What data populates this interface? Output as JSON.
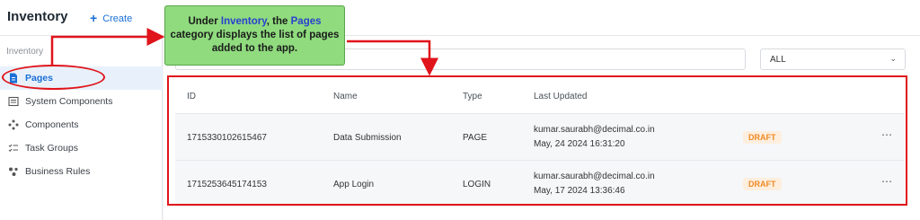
{
  "header": {
    "title": "Inventory",
    "create_label": "Create"
  },
  "sidebar": {
    "section_label": "Inventory",
    "items": [
      {
        "label": "Pages",
        "icon": "page-icon",
        "active": true
      },
      {
        "label": "System Components",
        "icon": "list-icon"
      },
      {
        "label": "Components",
        "icon": "components-icon"
      },
      {
        "label": "Task Groups",
        "icon": "task-groups-icon"
      },
      {
        "label": "Business Rules",
        "icon": "rules-icon"
      }
    ]
  },
  "filter": {
    "selected": "ALL"
  },
  "table": {
    "columns": [
      "ID",
      "Name",
      "Type",
      "Last Updated"
    ],
    "rows": [
      {
        "id": "1715330102615467",
        "name": "Data Submission",
        "type": "PAGE",
        "updated_by": "kumar.saurabh@decimal.co.in",
        "updated_at": "May, 24 2024 16:31:20",
        "status": "DRAFT"
      },
      {
        "id": "1715253645174153",
        "name": "App Login",
        "type": "LOGIN",
        "updated_by": "kumar.saurabh@decimal.co.in",
        "updated_at": "May, 17 2024 13:36:46",
        "status": "DRAFT"
      }
    ]
  },
  "annotation": {
    "text_1": "Under ",
    "highlight_1": "Inventory",
    "text_2": ", the ",
    "highlight_2": "Pages",
    "text_3": " category displays the list of pages added to the app."
  },
  "colors": {
    "accent": "#1a6fd6",
    "annotation_red": "#e0141b",
    "callout_green": "#8fdb7e",
    "draft_orange": "#f08a24"
  }
}
